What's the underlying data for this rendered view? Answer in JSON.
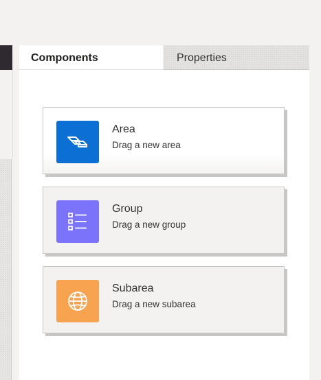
{
  "tabs": {
    "components": "Components",
    "properties": "Properties"
  },
  "components": [
    {
      "title": "Area",
      "subtitle": "Drag a new area",
      "icon": "area-icon",
      "color": "#0b6fd4"
    },
    {
      "title": "Group",
      "subtitle": "Drag a new group",
      "icon": "group-list-icon",
      "color": "#7b74fb"
    },
    {
      "title": "Subarea",
      "subtitle": "Drag a new subarea",
      "icon": "globe-icon",
      "color": "#f7a350"
    }
  ]
}
